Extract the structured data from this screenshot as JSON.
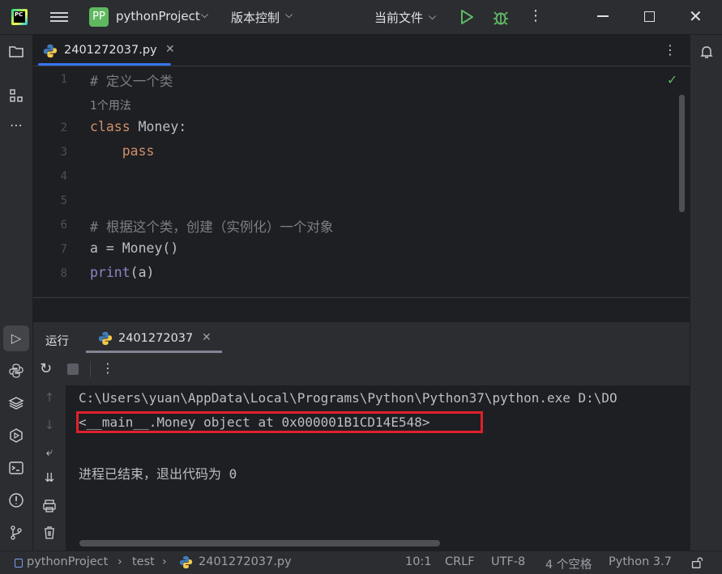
{
  "titlebar": {
    "logo_text": "PC",
    "project_badge": "PP",
    "project_name": "pythonProject",
    "vcs_label": "版本控制",
    "run_config": "当前文件"
  },
  "editor": {
    "tab_label": "2401272037.py",
    "lines": [
      {
        "n": "1",
        "text": "# 定义一个类"
      },
      {
        "hint": "1个用法"
      },
      {
        "n": "2",
        "kw": "class",
        "rest": " Money:"
      },
      {
        "n": "3",
        "indent": "    ",
        "kw": "pass"
      },
      {
        "n": "4"
      },
      {
        "n": "5"
      },
      {
        "n": "6",
        "text": "# 根据这个类，创建（实例化）一个对象"
      },
      {
        "n": "7",
        "text": "a = Money()"
      },
      {
        "n": "8",
        "fn": "print",
        "rest": "(a)"
      }
    ]
  },
  "run_panel": {
    "title": "运行",
    "tab_label": "2401272037",
    "console": [
      "C:\\Users\\yuan\\AppData\\Local\\Programs\\Python\\Python37\\python.exe D:\\DO",
      "<__main__.Money object at 0x000001B1CD14E548>",
      "",
      "进程已结束，退出代码为 0"
    ]
  },
  "statusbar": {
    "project": "pythonProject",
    "folder": "test",
    "file": "2401272037.py",
    "position": "10:1",
    "line_sep": "CRLF",
    "encoding": "UTF-8",
    "indent": "4 个空格",
    "interpreter": "Python 3.7"
  },
  "icons": [
    "hamburger-icon",
    "run-icon",
    "debug-icon",
    "folder-icon",
    "structure-icon",
    "more-icon",
    "bell-icon",
    "python-icon",
    "rerun-icon",
    "stop-icon",
    "wrap-icon",
    "scroll-end-icon",
    "print-icon",
    "trash-icon",
    "lock-icon"
  ],
  "colors": {
    "accent": "#3574f0",
    "highlight_box": "#e0202a",
    "run_green": "#5fb865"
  }
}
